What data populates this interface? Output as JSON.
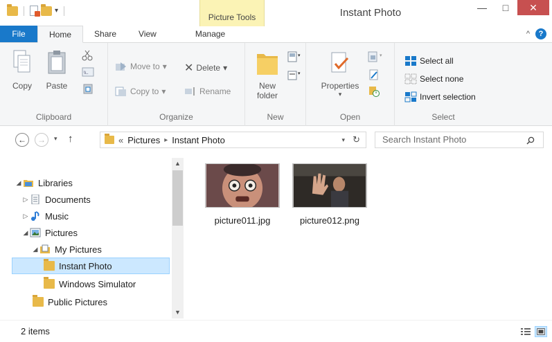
{
  "window": {
    "title": "Instant Photo",
    "contextual_tab": "Picture Tools"
  },
  "titlebar_controls": {
    "minimize": "—",
    "maximize": "□",
    "close": "✕"
  },
  "ribbon_tabs": [
    {
      "label": "File"
    },
    {
      "label": "Home"
    },
    {
      "label": "Share"
    },
    {
      "label": "View"
    },
    {
      "label": "Manage"
    }
  ],
  "ribbon": {
    "clipboard": {
      "label": "Clipboard",
      "copy": "Copy",
      "paste": "Paste"
    },
    "organize": {
      "label": "Organize",
      "move_to": "Move to",
      "copy_to": "Copy to",
      "delete": "Delete",
      "rename": "Rename"
    },
    "new": {
      "label": "New",
      "new_folder_line1": "New",
      "new_folder_line2": "folder"
    },
    "open": {
      "label": "Open",
      "properties": "Properties"
    },
    "select": {
      "label": "Select",
      "select_all": "Select all",
      "select_none": "Select none",
      "invert": "Invert selection"
    }
  },
  "address": {
    "overflow": "«",
    "crumbs": [
      "Pictures",
      "Instant Photo"
    ],
    "separator": "▸",
    "search_placeholder": "Search Instant Photo"
  },
  "nav_tree": [
    {
      "label": "Libraries",
      "expander": "◢",
      "icon": "libraries-icon"
    },
    {
      "label": "Documents",
      "expander": "▷",
      "icon": "documents-icon"
    },
    {
      "label": "Music",
      "expander": "▷",
      "icon": "music-icon"
    },
    {
      "label": "Pictures",
      "expander": "◢",
      "icon": "pictures-icon"
    },
    {
      "label": "My Pictures",
      "expander": "◢",
      "icon": "my-pictures-icon"
    },
    {
      "label": "Instant Photo",
      "expander": "",
      "icon": "folder-icon",
      "selected": true
    },
    {
      "label": "Windows Simulator",
      "expander": "",
      "icon": "folder-icon"
    },
    {
      "label": "Public Pictures",
      "expander": "",
      "icon": "folder-icon"
    }
  ],
  "files": [
    {
      "name": "picture011.jpg",
      "icon": "photo-thumbnail-face-icon"
    },
    {
      "name": "picture012.png",
      "icon": "photo-thumbnail-wave-icon"
    }
  ],
  "status": {
    "item_count": "2 items"
  },
  "colors": {
    "accent": "#1979ca",
    "contextual": "#fbf3b5",
    "close": "#c75050",
    "selection": "#cce8ff",
    "folder": "#e8b949"
  }
}
